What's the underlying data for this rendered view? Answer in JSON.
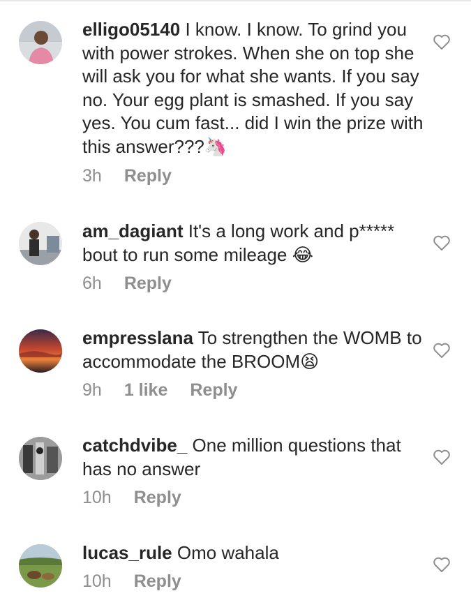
{
  "comments": [
    {
      "username": "elligo05140",
      "text": "I know. I know. To grind you with power strokes. When she on top she will ask you for what she wants. If you say no. Your egg plant is smashed. If you say yes. You cum fast... did I win the prize with this answer???",
      "emoji": "🦄",
      "time": "3h",
      "likes": "",
      "reply": "Reply"
    },
    {
      "username": "am_dagiant",
      "text": "It's a long work and p***** bout to run some mileage",
      "emoji": "😂",
      "time": "6h",
      "likes": "",
      "reply": "Reply"
    },
    {
      "username": "empresslana",
      "text": "To strengthen the WOMB to accommodate the BROOM",
      "emoji": "😫",
      "time": "9h",
      "likes": "1 like",
      "reply": "Reply"
    },
    {
      "username": "catchdvibe_",
      "text": "One million questions that has no answer",
      "emoji": "",
      "time": "10h",
      "likes": "",
      "reply": "Reply"
    },
    {
      "username": "lucas_rule",
      "text": "Omo wahala",
      "emoji": "",
      "time": "10h",
      "likes": "",
      "reply": "Reply"
    }
  ],
  "icons": {
    "like": "heart-outline-icon"
  },
  "colors": {
    "text": "#262626",
    "meta": "#8e8e8e"
  }
}
